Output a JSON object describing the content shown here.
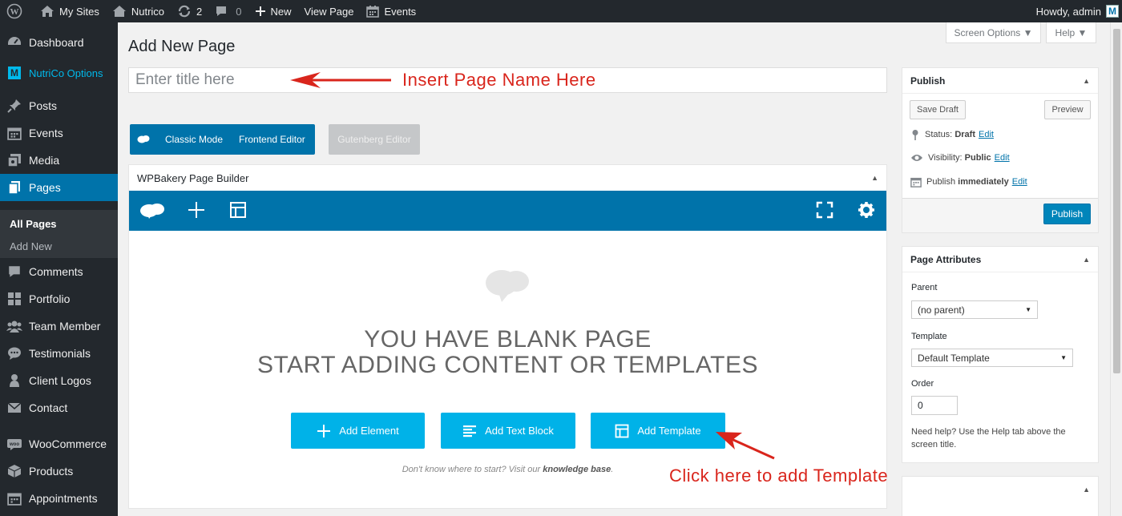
{
  "adminbar": {
    "my_sites": "My Sites",
    "site_name": "Nutrico",
    "updates_count": "2",
    "comments_count": "0",
    "new_label": "New",
    "view_page": "View Page",
    "events": "Events",
    "howdy": "Howdy, admin",
    "avatar_letter": "M"
  },
  "sidebar": {
    "dashboard": "Dashboard",
    "nutrico_options": "NutriCo Options",
    "nutrico_logo": "M",
    "posts": "Posts",
    "events": "Events",
    "media": "Media",
    "pages": "Pages",
    "all_pages": "All Pages",
    "add_new": "Add New",
    "comments": "Comments",
    "portfolio": "Portfolio",
    "team_member": "Team Member",
    "testimonials": "Testimonials",
    "client_logos": "Client Logos",
    "contact": "Contact",
    "woocommerce": "WooCommerce",
    "products": "Products",
    "appointments": "Appointments"
  },
  "screen_options": "Screen Options ▼",
  "help_tab": "Help ▼",
  "page_title": "Add New Page",
  "title_placeholder": "Enter title here",
  "annotations": {
    "insert_name": "Insert Page Name Here",
    "click_template": "Click here to add Template"
  },
  "editor_modes": {
    "classic": "Classic Mode",
    "frontend": "Frontend Editor",
    "gutenberg": "Gutenberg Editor"
  },
  "wpbakery": {
    "title": "WPBakery Page Builder",
    "blank_line1": "YOU HAVE BLANK PAGE",
    "blank_line2": "START ADDING CONTENT OR TEMPLATES",
    "add_element": "Add Element",
    "add_text_block": "Add Text Block",
    "add_template": "Add Template",
    "help_prefix": "Don't know where to start? Visit our",
    "help_link": "knowledge base",
    "help_suffix": "."
  },
  "publish_box": {
    "title": "Publish",
    "save_draft": "Save Draft",
    "preview": "Preview",
    "status_label": "Status:",
    "status_value": "Draft",
    "visibility_label": "Visibility:",
    "visibility_value": "Public",
    "publish_label": "Publish",
    "publish_value": "immediately",
    "edit": "Edit",
    "publish_button": "Publish"
  },
  "page_attributes": {
    "title": "Page Attributes",
    "parent_label": "Parent",
    "parent_value": "(no parent)",
    "template_label": "Template",
    "template_value": "Default Template",
    "order_label": "Order",
    "order_value": "0",
    "help_text": "Need help? Use the Help tab above the screen title."
  },
  "colors": {
    "accent": "#0073aa",
    "builder_button": "#00b2e8",
    "annotation": "#d9251c",
    "admin_dark": "#23282d"
  }
}
